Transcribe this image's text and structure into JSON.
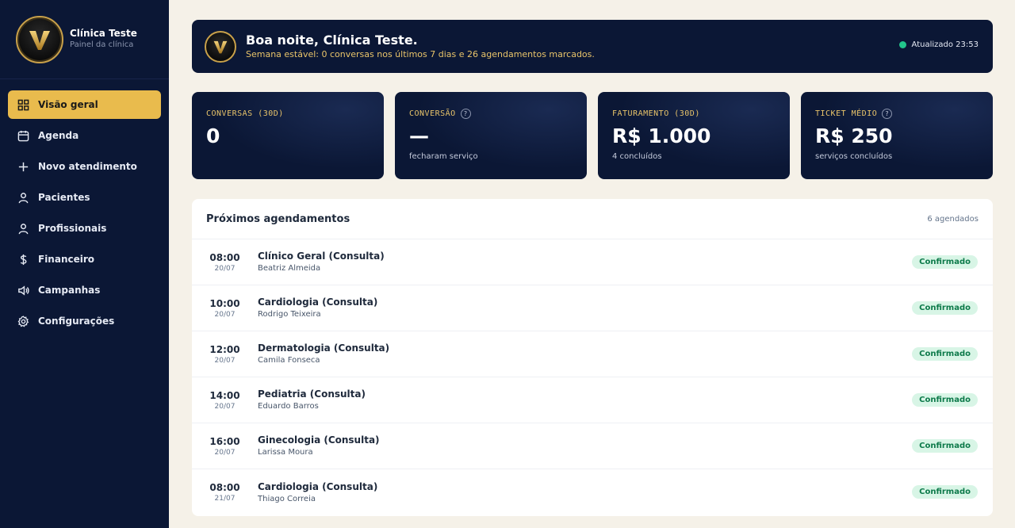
{
  "brand": {
    "initial": "V",
    "name": "Clínica Teste",
    "subtitle": "Painel da clínica"
  },
  "nav": [
    {
      "label": "Visão geral",
      "icon": "grid-icon",
      "active": true
    },
    {
      "label": "Agenda",
      "icon": "calendar-icon"
    },
    {
      "label": "Novo atendimento",
      "icon": "plus-icon"
    },
    {
      "label": "Pacientes",
      "icon": "user-icon"
    },
    {
      "label": "Profissionais",
      "icon": "user-icon"
    },
    {
      "label": "Financeiro",
      "icon": "dollar-icon"
    },
    {
      "label": "Campanhas",
      "icon": "megaphone-icon"
    },
    {
      "label": "Configurações",
      "icon": "gear-icon"
    }
  ],
  "header": {
    "greeting": "Boa noite, Clínica Teste.",
    "summary": "Semana estável: 0 conversas nos últimos 7 dias e 26 agendamentos marcados.",
    "updated": "Atualizado 23:53"
  },
  "stats": [
    {
      "label": "CONVERSAS (30D)",
      "value": "0",
      "sub": "",
      "help": false
    },
    {
      "label": "CONVERSÃO",
      "value": "—",
      "sub": "fecharam serviço",
      "help": true
    },
    {
      "label": "FATURAMENTO (30D)",
      "value": "R$ 1.000",
      "sub": "4 concluídos",
      "help": false
    },
    {
      "label": "TICKET MÉDIO",
      "value": "R$ 250",
      "sub": "serviços concluídos",
      "help": true
    }
  ],
  "help_glyph": "?",
  "appointments": {
    "title": "Próximos agendamentos",
    "count": "6 agendados",
    "items": [
      {
        "time": "08:00",
        "date": "20/07",
        "service": "Clínico Geral (Consulta)",
        "patient": "Beatriz Almeida",
        "status": "Confirmado"
      },
      {
        "time": "10:00",
        "date": "20/07",
        "service": "Cardiologia (Consulta)",
        "patient": "Rodrigo Teixeira",
        "status": "Confirmado"
      },
      {
        "time": "12:00",
        "date": "20/07",
        "service": "Dermatologia (Consulta)",
        "patient": "Camila Fonseca",
        "status": "Confirmado"
      },
      {
        "time": "14:00",
        "date": "20/07",
        "service": "Pediatria (Consulta)",
        "patient": "Eduardo Barros",
        "status": "Confirmado"
      },
      {
        "time": "16:00",
        "date": "20/07",
        "service": "Ginecologia (Consulta)",
        "patient": "Larissa Moura",
        "status": "Confirmado"
      },
      {
        "time": "08:00",
        "date": "21/07",
        "service": "Cardiologia (Consulta)",
        "patient": "Thiago Correia",
        "status": "Confirmado"
      }
    ]
  },
  "colors": {
    "navy": "#0b1735",
    "gold": "#e9bb4d",
    "success": "#22c58b",
    "background": "#f5f1e8"
  }
}
